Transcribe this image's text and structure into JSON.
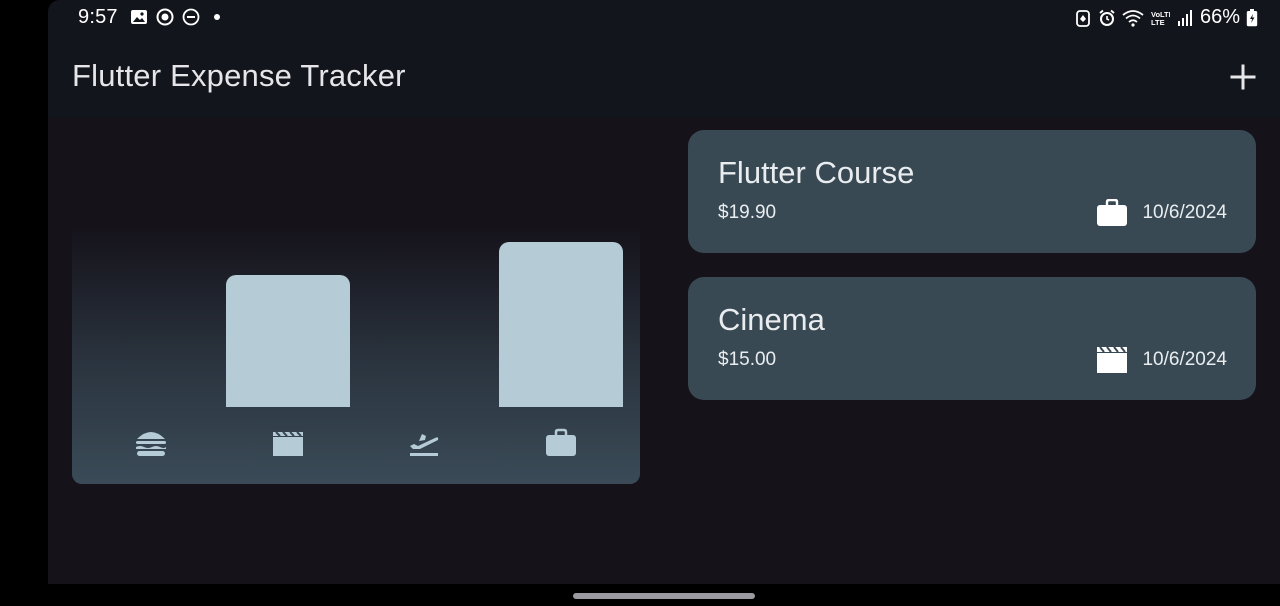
{
  "status_bar": {
    "time": "9:57",
    "battery": "66%",
    "left_icons": [
      "gallery-icon",
      "media-record-icon",
      "do-not-disturb-icon",
      "notification-dot-icon"
    ],
    "right_icons": [
      "battery-saver-icon",
      "alarm-icon",
      "wifi-icon",
      "volte-icon",
      "signal-icon",
      "battery-icon"
    ]
  },
  "app_bar": {
    "title": "Flutter Expense Tracker",
    "action_icon": "add-icon"
  },
  "chart": {
    "categories": [
      {
        "name": "food",
        "icon": "burger-icon",
        "fill": 0
      },
      {
        "name": "leisure",
        "icon": "clapperboard-icon",
        "fill": 0.803
      },
      {
        "name": "travel",
        "icon": "flight-takeoff-icon",
        "fill": 0
      },
      {
        "name": "work",
        "icon": "briefcase-icon",
        "fill": 1.0
      }
    ],
    "bar_color": "#b5cbd6"
  },
  "expenses": [
    {
      "title": "Flutter Course",
      "amount": "$19.90",
      "date": "10/6/2024",
      "icon": "briefcase-icon"
    },
    {
      "title": "Cinema",
      "amount": "$15.00",
      "date": "10/6/2024",
      "icon": "clapperboard-icon"
    }
  ],
  "colors": {
    "background": "#15121a",
    "app_bar": "#12151b",
    "card": "#394953",
    "text": "#e9edf0"
  }
}
